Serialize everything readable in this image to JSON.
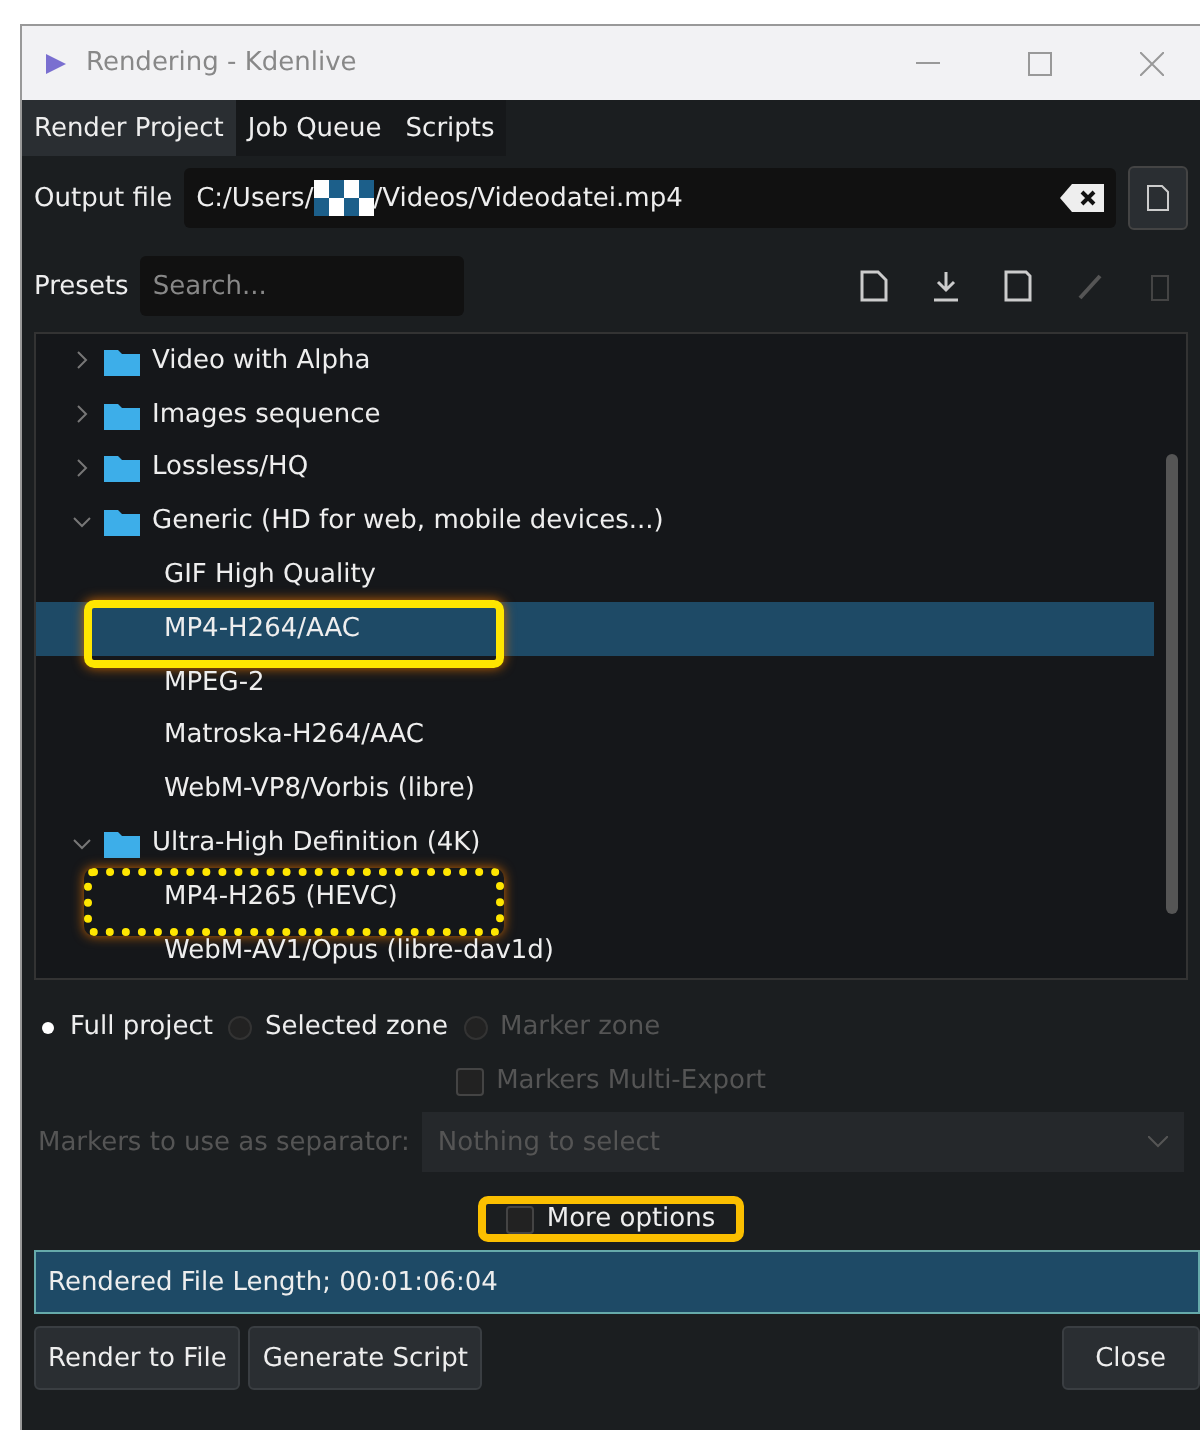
{
  "window": {
    "title": "Rendering - Kdenlive"
  },
  "tabs": [
    {
      "label": "Render Project",
      "selected": true
    },
    {
      "label": "Job Queue",
      "selected": false
    },
    {
      "label": "Scripts",
      "selected": false
    }
  ],
  "output": {
    "label": "Output file",
    "path_start": "C:/Users/",
    "path_end": "/Videos/Videodatei.mp4"
  },
  "presets": {
    "label": "Presets",
    "placeholder": "Search..."
  },
  "tree": [
    {
      "label": "Video with Alpha",
      "expanded": false
    },
    {
      "label": "Images sequence",
      "expanded": false
    },
    {
      "label": "Lossless/HQ",
      "expanded": false
    },
    {
      "label": "Generic (HD for web, mobile devices...)",
      "expanded": true,
      "children": [
        {
          "label": "GIF High Quality",
          "selected": false,
          "highlighted": false
        },
        {
          "label": "MP4-H264/AAC",
          "selected": true,
          "highlighted": true,
          "dotted": false
        },
        {
          "label": "MPEG-2",
          "selected": false,
          "highlighted": false
        },
        {
          "label": "Matroska-H264/AAC",
          "selected": false,
          "highlighted": false
        },
        {
          "label": "WebM-VP8/Vorbis (libre)",
          "selected": false,
          "highlighted": false
        }
      ]
    },
    {
      "label": "Ultra-High Definition (4K)",
      "expanded": true,
      "children": [
        {
          "label": "MP4-H265 (HEVC)",
          "selected": false,
          "highlighted": true,
          "dotted": true
        },
        {
          "label": "WebM-AV1/Opus (libre-dav1d)",
          "selected": false,
          "highlighted": false
        }
      ]
    }
  ],
  "zones": [
    {
      "label": "Full project",
      "selected": true,
      "disabled": false
    },
    {
      "label": "Selected zone",
      "selected": false,
      "disabled": false
    },
    {
      "label": "Marker zone",
      "selected": false,
      "disabled": true
    }
  ],
  "markers_export": {
    "label": "Markers Multi-Export",
    "checked": false,
    "disabled": true
  },
  "separator": {
    "label": "Markers to use as separator:",
    "value": "Nothing to select",
    "disabled": true
  },
  "more_options": {
    "label": "More options",
    "checked": false,
    "highlighted": true
  },
  "length": "Rendered File Length; 00:01:06:04",
  "buttons": [
    "Render to File",
    "Generate Script"
  ],
  "close_button": "Close"
}
